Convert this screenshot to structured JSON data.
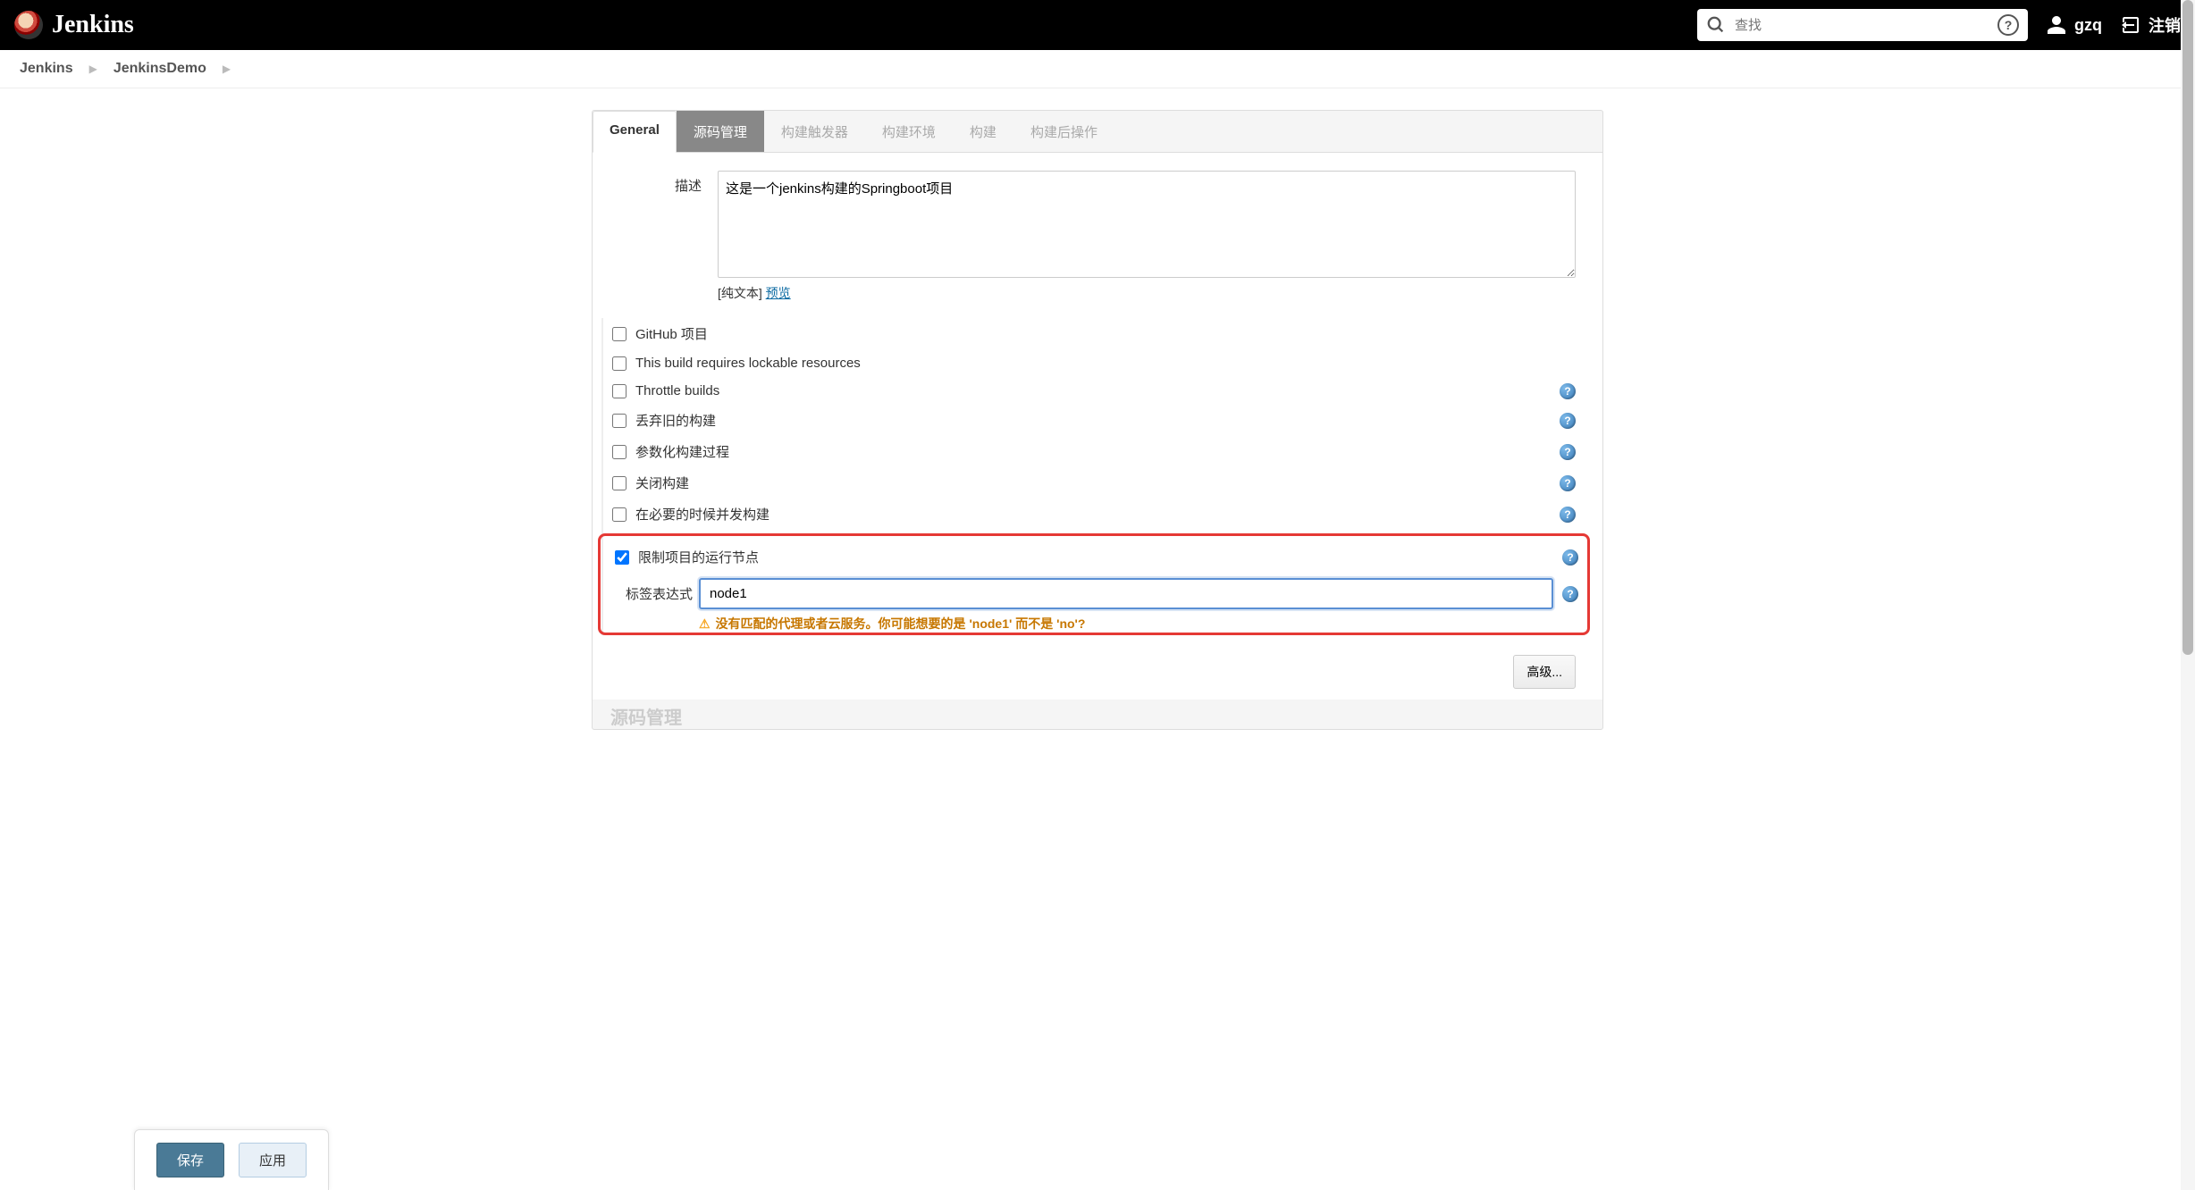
{
  "header": {
    "logo_text": "Jenkins",
    "search_placeholder": "查找",
    "username": "gzq",
    "logout_label": "注销"
  },
  "breadcrumb": {
    "items": [
      "Jenkins",
      "JenkinsDemo"
    ]
  },
  "tabs": [
    {
      "label": "General",
      "state": "active"
    },
    {
      "label": "源码管理",
      "state": "highlighted"
    },
    {
      "label": "构建触发器",
      "state": "normal"
    },
    {
      "label": "构建环境",
      "state": "normal"
    },
    {
      "label": "构建",
      "state": "normal"
    },
    {
      "label": "构建后操作",
      "state": "normal"
    }
  ],
  "form": {
    "description_label": "描述",
    "description_value": "这是一个jenkins构建的Springboot项目",
    "plain_text_prefix": "[纯文本] ",
    "preview_link": "预览"
  },
  "checkboxes": [
    {
      "label": "GitHub 项目",
      "checked": false,
      "help": false
    },
    {
      "label": "This build requires lockable resources",
      "checked": false,
      "help": false
    },
    {
      "label": "Throttle builds",
      "checked": false,
      "help": true
    },
    {
      "label": "丢弃旧的构建",
      "checked": false,
      "help": true
    },
    {
      "label": "参数化构建过程",
      "checked": false,
      "help": true
    },
    {
      "label": "关闭构建",
      "checked": false,
      "help": true
    },
    {
      "label": "在必要的时候并发构建",
      "checked": false,
      "help": true
    }
  ],
  "restrict": {
    "checkbox_label": "限制项目的运行节点",
    "checked": true,
    "label_expr_label": "标签表达式",
    "label_expr_value": "node1",
    "warning_text": "没有匹配的代理或者云服务。你可能想要的是 'node1' 而不是 'no'?"
  },
  "buttons": {
    "advanced": "高级...",
    "save": "保存",
    "apply": "应用"
  },
  "faded_next_section": "源码管理"
}
